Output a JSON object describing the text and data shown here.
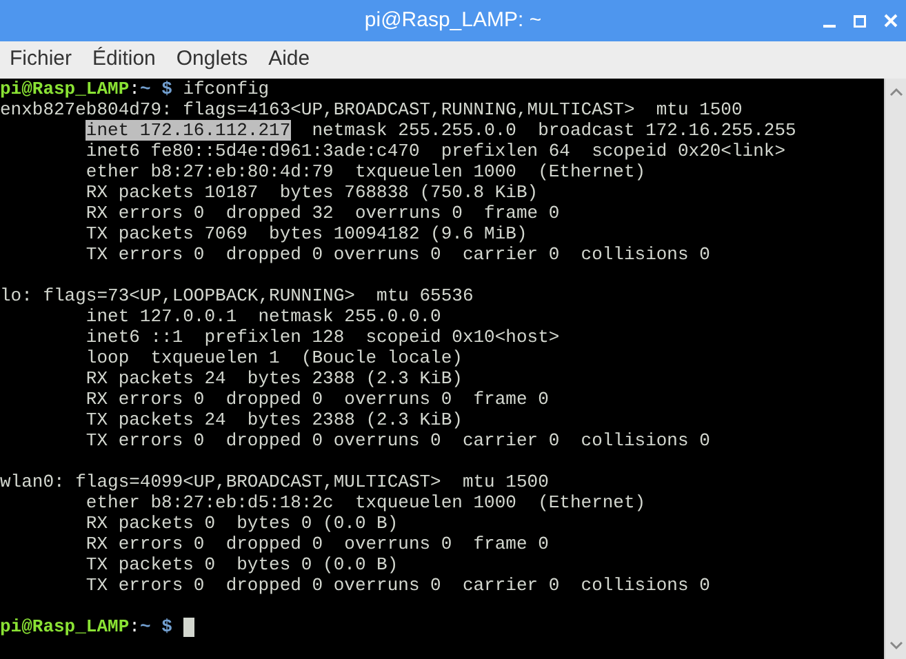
{
  "window": {
    "title": "pi@Rasp_LAMP: ~"
  },
  "menu": [
    "Fichier",
    "Édition",
    "Onglets",
    "Aide"
  ],
  "terminal": {
    "lines": [
      {
        "kind": "prompt",
        "user_host": "pi@Rasp_LAMP",
        "separator": ":",
        "path": "~",
        "symbol": "$",
        "command": "ifconfig",
        "cursor": false
      },
      {
        "kind": "output",
        "text": "enxb827eb804d79: flags=4163<UP,BROADCAST,RUNNING,MULTICAST>  mtu 1500"
      },
      {
        "kind": "selection",
        "selected_text": "inet 172.16.112.217",
        "rest": "  netmask 255.255.0.0  broadcast 172.16.255.255"
      },
      {
        "kind": "output",
        "text": "        inet6 fe80::5d4e:d961:3ade:c470  prefixlen 64  scopeid 0x20<link>"
      },
      {
        "kind": "output",
        "text": "        ether b8:27:eb:80:4d:79  txqueuelen 1000  (Ethernet)"
      },
      {
        "kind": "output",
        "text": "        RX packets 10187  bytes 768838 (750.8 KiB)"
      },
      {
        "kind": "output",
        "text": "        RX errors 0  dropped 32  overruns 0  frame 0"
      },
      {
        "kind": "output",
        "text": "        TX packets 7069  bytes 10094182 (9.6 MiB)"
      },
      {
        "kind": "output",
        "text": "        TX errors 0  dropped 0 overruns 0  carrier 0  collisions 0"
      },
      {
        "kind": "blank"
      },
      {
        "kind": "output",
        "text": "lo: flags=73<UP,LOOPBACK,RUNNING>  mtu 65536"
      },
      {
        "kind": "output",
        "text": "        inet 127.0.0.1  netmask 255.0.0.0"
      },
      {
        "kind": "output",
        "text": "        inet6 ::1  prefixlen 128  scopeid 0x10<host>"
      },
      {
        "kind": "output",
        "text": "        loop  txqueuelen 1  (Boucle locale)"
      },
      {
        "kind": "output",
        "text": "        RX packets 24  bytes 2388 (2.3 KiB)"
      },
      {
        "kind": "output",
        "text": "        RX errors 0  dropped 0  overruns 0  frame 0"
      },
      {
        "kind": "output",
        "text": "        TX packets 24  bytes 2388 (2.3 KiB)"
      },
      {
        "kind": "output",
        "text": "        TX errors 0  dropped 0 overruns 0  carrier 0  collisions 0"
      },
      {
        "kind": "blank"
      },
      {
        "kind": "output",
        "text": "wlan0: flags=4099<UP,BROADCAST,MULTICAST>  mtu 1500"
      },
      {
        "kind": "output",
        "text": "        ether b8:27:eb:d5:18:2c  txqueuelen 1000  (Ethernet)"
      },
      {
        "kind": "output",
        "text": "        RX packets 0  bytes 0 (0.0 B)"
      },
      {
        "kind": "output",
        "text": "        RX errors 0  dropped 0  overruns 0  frame 0"
      },
      {
        "kind": "output",
        "text": "        TX packets 0  bytes 0 (0.0 B)"
      },
      {
        "kind": "output",
        "text": "        TX errors 0  dropped 0 overruns 0  carrier 0  collisions 0"
      },
      {
        "kind": "blank"
      },
      {
        "kind": "prompt",
        "user_host": "pi@Rasp_LAMP",
        "separator": ":",
        "path": "~",
        "symbol": "$",
        "cursor": true
      }
    ]
  }
}
